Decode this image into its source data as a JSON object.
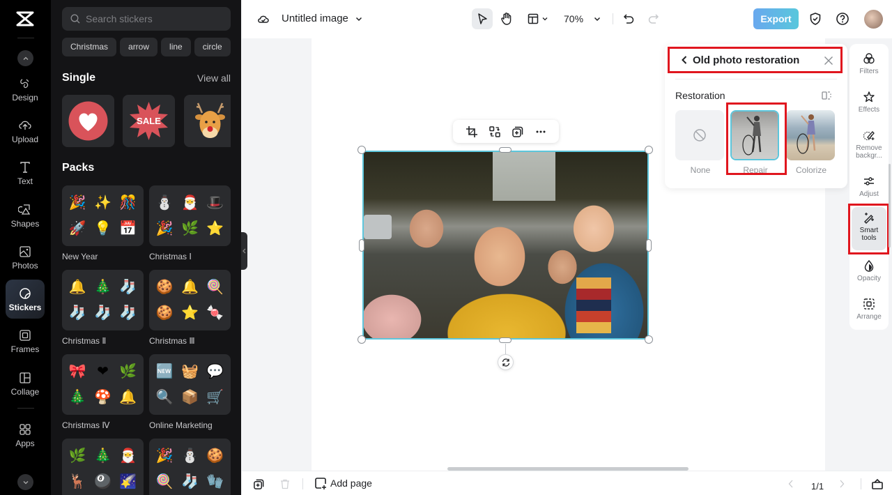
{
  "rail": {
    "items": [
      {
        "label": "Design",
        "icon": "design-icon"
      },
      {
        "label": "Upload",
        "icon": "upload-icon"
      },
      {
        "label": "Text",
        "icon": "text-icon"
      },
      {
        "label": "Shapes",
        "icon": "shapes-icon"
      },
      {
        "label": "Photos",
        "icon": "photos-icon"
      },
      {
        "label": "Stickers",
        "icon": "stickers-icon",
        "active": true
      },
      {
        "label": "Frames",
        "icon": "frames-icon"
      },
      {
        "label": "Collage",
        "icon": "collage-icon"
      },
      {
        "label": "Apps",
        "icon": "apps-icon"
      }
    ]
  },
  "stickers": {
    "search_placeholder": "Search stickers",
    "chips": [
      "Christmas",
      "arrow",
      "line",
      "circle"
    ],
    "single_title": "Single",
    "view_all": "View all",
    "single_items": [
      "heart",
      "sale-badge",
      "reindeer"
    ],
    "packs_title": "Packs",
    "packs": [
      {
        "name": "New Year",
        "glyphs": [
          "🎉",
          "✨",
          "🎊",
          "🚀",
          "💡",
          "📅"
        ]
      },
      {
        "name": "Christmas Ⅰ",
        "glyphs": [
          "⛄",
          "🎅",
          "🎩",
          "🎉",
          "🌿",
          "⭐"
        ]
      },
      {
        "name": "Christmas Ⅱ",
        "glyphs": [
          "🔔",
          "🎄",
          "🧦",
          "🧦",
          "🧦",
          "🧦"
        ]
      },
      {
        "name": "Christmas Ⅲ",
        "glyphs": [
          "🍪",
          "🔔",
          "🍭",
          "🍪",
          "⭐",
          "🍬"
        ]
      },
      {
        "name": "Christmas Ⅳ",
        "glyphs": [
          "🎀",
          "❤",
          "🌿",
          "🎄",
          "🍄",
          "🔔"
        ]
      },
      {
        "name": "Online Marketing",
        "glyphs": [
          "🆕",
          "🧺",
          "💬",
          "🔍",
          "📦",
          "🛒"
        ]
      },
      {
        "name": "",
        "glyphs": [
          "🌿",
          "🎄",
          "🎅",
          "🦌",
          "🎱",
          "🌠"
        ]
      },
      {
        "name": "",
        "glyphs": [
          "🎉",
          "⛄",
          "🍪",
          "🍭",
          "🧦",
          "🧤"
        ]
      }
    ]
  },
  "topbar": {
    "title": "Untitled image",
    "zoom": "70%",
    "export_label": "Export"
  },
  "restoration": {
    "title": "Old photo restoration",
    "section": "Restoration",
    "options": [
      {
        "label": "None"
      },
      {
        "label": "Repair",
        "selected": true
      },
      {
        "label": "Colorize"
      }
    ]
  },
  "tools": {
    "items": [
      {
        "label": "Filters"
      },
      {
        "label": "Effects"
      },
      {
        "label": "Remove backgr..."
      },
      {
        "label": "Adjust"
      },
      {
        "label": "Smart tools",
        "active": true
      },
      {
        "label": "Opacity"
      },
      {
        "label": "Arrange"
      }
    ]
  },
  "bottombar": {
    "add_page": "Add page",
    "pager": "1/1"
  },
  "colors": {
    "accent": "#5dc6dc",
    "highlight": "#e0161e",
    "export_gradient_start": "#69a8ee",
    "export_gradient_end": "#58c7dc"
  }
}
